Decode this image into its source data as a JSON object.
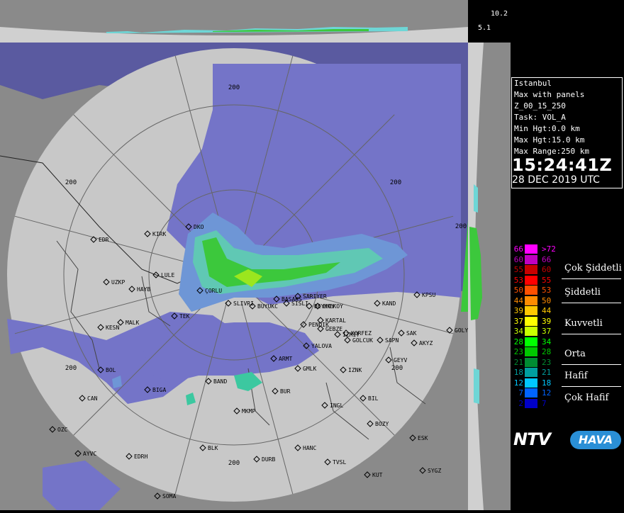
{
  "scale_top": {
    "val1": "10.2",
    "val2": "5.1"
  },
  "info": {
    "station": "Istanbul",
    "product": "Max with panels",
    "scan": "Z_00_15_250",
    "task": "Task: VOL_A",
    "min_hgt": "Min Hgt:0.0 km",
    "max_hgt": "Max Hgt:15.0 km",
    "max_range": "Max Range:250 km",
    "time": "15:24:41Z",
    "date": "28 DEC 2019 UTC"
  },
  "legend": {
    "rows": [
      {
        "left": "66",
        "right": ">72",
        "color": "#ff00ff"
      },
      {
        "left": "60",
        "right": "66",
        "color": "#c000c0"
      },
      {
        "left": "55",
        "right": "60",
        "color": "#c80000"
      },
      {
        "left": "53",
        "right": "55",
        "color": "#ff0000"
      },
      {
        "left": "50",
        "right": "53",
        "color": "#ff5000"
      },
      {
        "left": "44",
        "right": "50",
        "color": "#ff8c00"
      },
      {
        "left": "39",
        "right": "44",
        "color": "#ffc800"
      },
      {
        "left": "37",
        "right": "39",
        "color": "#ffff00"
      },
      {
        "left": "34",
        "right": "37",
        "color": "#c8ff00"
      },
      {
        "left": "28",
        "right": "34",
        "color": "#00ff00"
      },
      {
        "left": "23",
        "right": "28",
        "color": "#00c800"
      },
      {
        "left": "21",
        "right": "23",
        "color": "#008c32"
      },
      {
        "left": "18",
        "right": "21",
        "color": "#00a0a0"
      },
      {
        "left": "12",
        "right": "18",
        "color": "#00c8ff"
      },
      {
        "left": "7",
        "right": "12",
        "color": "#0064ff"
      },
      {
        "left": "2",
        "right": "7",
        "color": "#0000c8"
      }
    ],
    "categories": [
      "Çok Şiddetli",
      "Şiddetli",
      "Kuvvetli",
      "Orta",
      "Hafif",
      "Çok Hafif"
    ]
  },
  "logo": {
    "ntv": "NTV",
    "hava": "HAVA"
  },
  "range_labels": [
    "200",
    "200",
    "200",
    "200",
    "200",
    "200",
    "200"
  ],
  "cities": [
    "EDR",
    "KIRK",
    "DKO",
    "LULE",
    "UZKP",
    "HAYB",
    "ÇORLU",
    "TEK",
    "MALK",
    "KESN",
    "SLIVRI",
    "BUYUKC",
    "BASAKS",
    "SARIYER",
    "SISLI",
    "BEYKOY",
    "EMEKOY",
    "KARTAL",
    "PENDIK",
    "GEBZE",
    "KORFEZ",
    "IZMIT",
    "GOLCUK",
    "YALOVA",
    "SAPN",
    "SAK",
    "AKYZ",
    "GOLY",
    "KAND",
    "KPSU",
    "ARMT",
    "GMLK",
    "IZNK",
    "GEYV",
    "BOL",
    "BIGA",
    "BAND",
    "BUR",
    "CAN",
    "MKMP",
    "INGL",
    "BIL",
    "BOZY",
    "OZC",
    "AYVC",
    "EDRH",
    "BLK",
    "HANC",
    "DURB",
    "TVSL",
    "ESK",
    "KUT",
    "SYGZ",
    "SOMA"
  ],
  "colors": {
    "sea": "#7474c8",
    "land": "#c8c8c8",
    "outside": "#8a8a8a",
    "rain_blue": "#6e96d6",
    "rain_green": "#3cc83c"
  }
}
